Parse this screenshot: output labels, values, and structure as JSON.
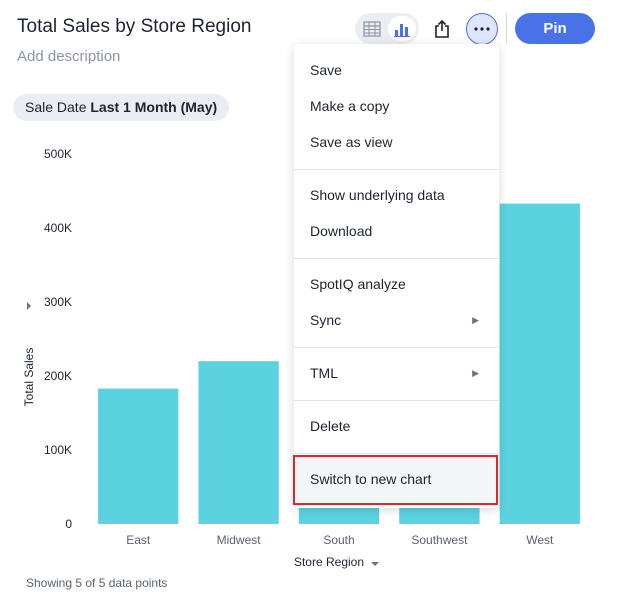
{
  "header": {
    "title": "Total Sales by Store Region",
    "description_placeholder": "Add description",
    "pin_label": "Pin"
  },
  "filter": {
    "label": "Sale Date",
    "value": "Last 1 Month (May)"
  },
  "toolbar": {
    "table_icon": "table-icon",
    "chart_icon": "bar-chart-icon",
    "share_icon": "share-icon",
    "more_icon": "more-icon",
    "active_view": "chart"
  },
  "menu": {
    "items": [
      {
        "label": "Save",
        "submenu": false
      },
      {
        "label": "Make a copy",
        "submenu": false
      },
      {
        "label": "Save as view",
        "submenu": false
      },
      {
        "label": "Show underlying data",
        "submenu": false
      },
      {
        "label": "Download",
        "submenu": false
      },
      {
        "label": "SpotIQ analyze",
        "submenu": false
      },
      {
        "label": "Sync",
        "submenu": true
      },
      {
        "label": "TML",
        "submenu": true
      },
      {
        "label": "Delete",
        "submenu": false
      },
      {
        "label": "Switch to new chart",
        "submenu": false
      }
    ],
    "arrow_glyph": "▶"
  },
  "footer": {
    "status": "Showing 5 of 5 data points"
  },
  "colors": {
    "bar": "#5bd2e0",
    "accent": "#4a72e8",
    "highlight": "#d9262f"
  },
  "chart_data": {
    "type": "bar",
    "categories": [
      "East",
      "Midwest",
      "South",
      "Southwest",
      "West"
    ],
    "values": [
      183000,
      220000,
      60000,
      60000,
      433000
    ],
    "xlabel": "Store Region",
    "ylabel": "Total Sales",
    "ylim": [
      0,
      500000
    ],
    "yticks": [
      0,
      100000,
      200000,
      300000,
      400000,
      500000
    ],
    "ytick_labels": [
      "0",
      "100K",
      "200K",
      "300K",
      "400K",
      "500K"
    ],
    "grid": false,
    "legend": "none"
  }
}
